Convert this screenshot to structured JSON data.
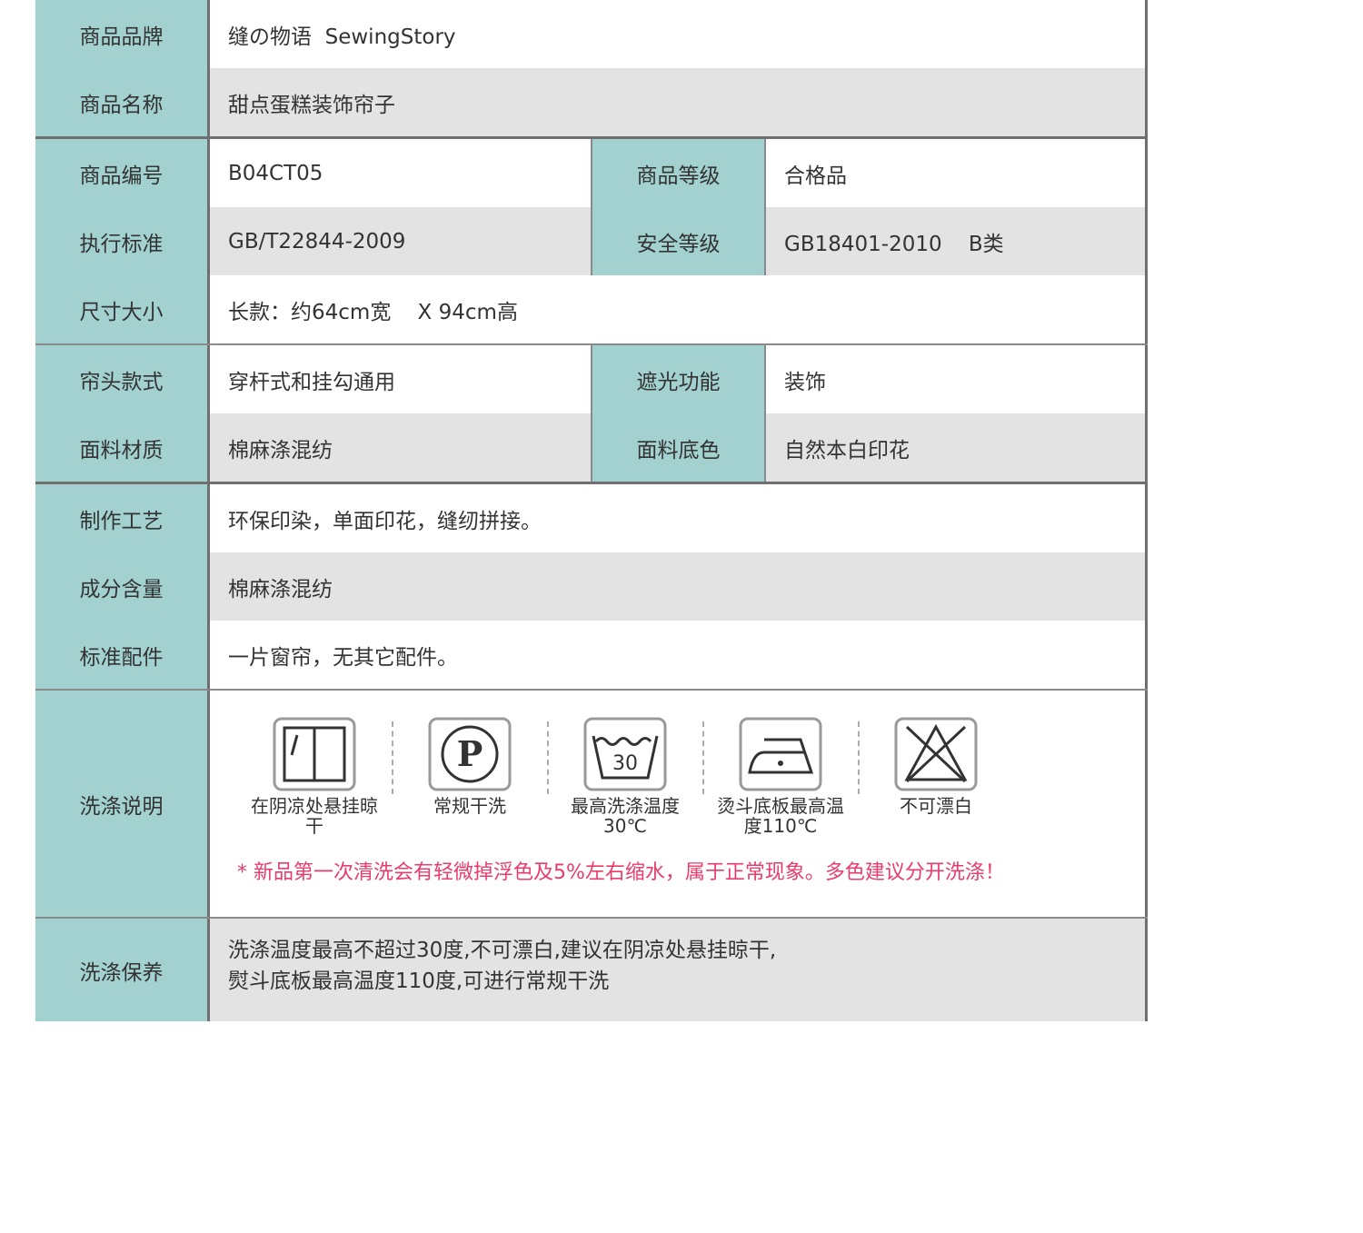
{
  "rows": {
    "brand": {
      "label": "商品品牌",
      "value": "缝の物语  SewingStory"
    },
    "name": {
      "label": "商品名称",
      "value": "甜点蛋糕装饰帘子"
    },
    "code": {
      "label": "商品编号",
      "value": "B04CT05",
      "label2": "商品等级",
      "value2": "合格品"
    },
    "standard": {
      "label": "执行标准",
      "value": "GB/T22844-2009",
      "label2": "安全等级",
      "value2": "GB18401-2010    B类"
    },
    "size": {
      "label": "尺寸大小",
      "value": "长款：约64cm宽    X 94cm高"
    },
    "header": {
      "label": "帘头款式",
      "value": "穿杆式和挂勾通用",
      "label2": "遮光功能",
      "value2": "装饰"
    },
    "fabric": {
      "label": "面料材质",
      "value": "棉麻涤混纺",
      "label2": "面料底色",
      "value2": "自然本白印花"
    },
    "craft": {
      "label": "制作工艺",
      "value": "环保印染，单面印花，缝纫拼接。"
    },
    "composition": {
      "label": "成分含量",
      "value": "棉麻涤混纺"
    },
    "accessories": {
      "label": "标准配件",
      "value": "一片窗帘，无其它配件。"
    }
  },
  "wash": {
    "label": "洗涤说明",
    "symbols": [
      {
        "icon": "shade-dry-icon",
        "caption": "在阴凉处悬挂晾干"
      },
      {
        "icon": "dry-clean-p-icon",
        "caption": "常规干洗",
        "glyph": "P"
      },
      {
        "icon": "wash-30-icon",
        "caption": "最高洗涤温度30℃",
        "glyph": "30"
      },
      {
        "icon": "iron-icon",
        "caption": "烫斗底板最高温度110℃"
      },
      {
        "icon": "no-bleach-icon",
        "caption": "不可漂白"
      }
    ],
    "warning": "* 新品第一次清洗会有轻微掉浮色及5%左右缩水，属于正常现象。多色建议分开洗涤！",
    "warning_color": "#ea3c6c"
  },
  "care": {
    "label": "洗涤保养",
    "line1": "洗涤温度最高不超过30度,不可漂白,建议在阴凉处悬挂晾干,",
    "line2": "熨斗底板最高温度110度,可进行常规干洗"
  },
  "colors": {
    "label_bg": "#a2d1cf",
    "row_alt": "#e3e3e3",
    "border": "#6f6f6f"
  }
}
